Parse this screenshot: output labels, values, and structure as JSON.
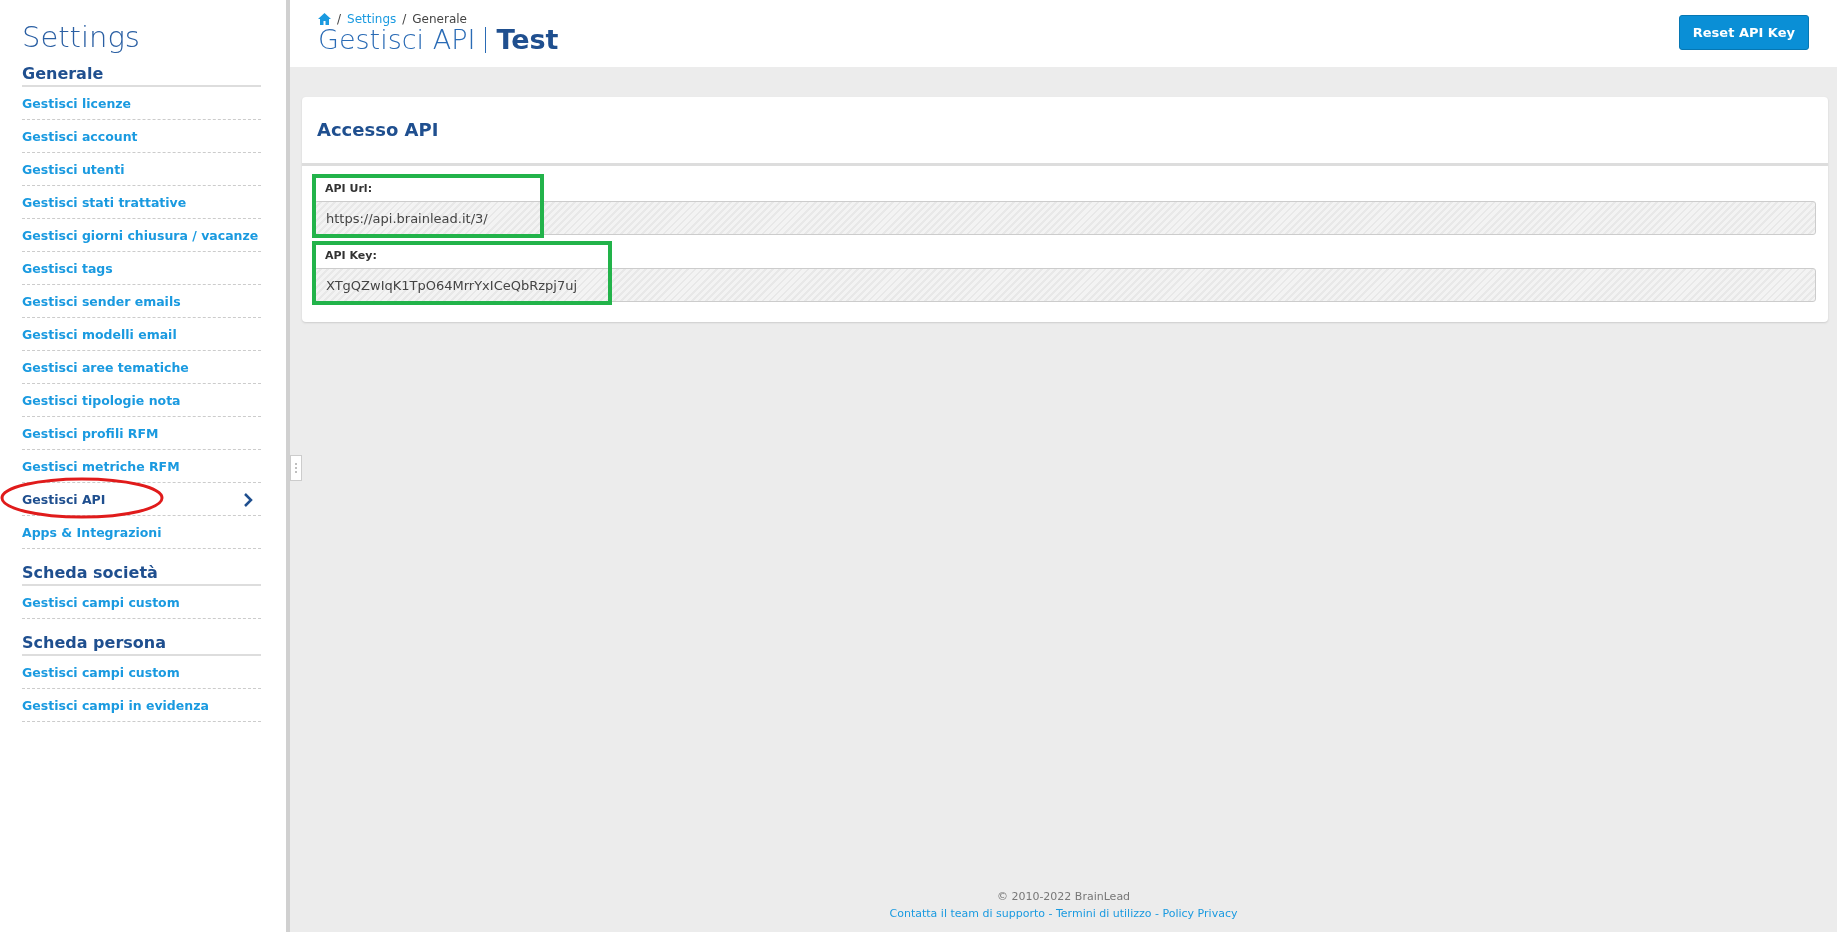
{
  "sidebar": {
    "title": "Settings",
    "sections": [
      {
        "heading": "Generale",
        "items": [
          {
            "label": "Gestisci licenze",
            "selected": false,
            "circled": false
          },
          {
            "label": "Gestisci account",
            "selected": false,
            "circled": false
          },
          {
            "label": "Gestisci utenti",
            "selected": false,
            "circled": false
          },
          {
            "label": "Gestisci stati trattative",
            "selected": false,
            "circled": false
          },
          {
            "label": "Gestisci giorni chiusura / vacanze",
            "selected": false,
            "circled": false
          },
          {
            "label": "Gestisci tags",
            "selected": false,
            "circled": false
          },
          {
            "label": "Gestisci sender emails",
            "selected": false,
            "circled": false
          },
          {
            "label": "Gestisci modelli email",
            "selected": false,
            "circled": false
          },
          {
            "label": "Gestisci aree tematiche",
            "selected": false,
            "circled": false
          },
          {
            "label": "Gestisci tipologie nota",
            "selected": false,
            "circled": false
          },
          {
            "label": "Gestisci profili RFM",
            "selected": false,
            "circled": false
          },
          {
            "label": "Gestisci metriche RFM",
            "selected": false,
            "circled": false
          },
          {
            "label": "Gestisci API",
            "selected": true,
            "circled": true
          },
          {
            "label": "Apps & Integrazioni",
            "selected": false,
            "circled": false
          }
        ]
      },
      {
        "heading": "Scheda società",
        "items": [
          {
            "label": "Gestisci campi custom",
            "selected": false,
            "circled": false
          }
        ]
      },
      {
        "heading": "Scheda persona",
        "items": [
          {
            "label": "Gestisci campi custom",
            "selected": false,
            "circled": false
          },
          {
            "label": "Gestisci campi in evidenza",
            "selected": false,
            "circled": false
          }
        ]
      }
    ]
  },
  "header": {
    "breadcrumb_separator": "/",
    "breadcrumb": [
      {
        "label": "Settings",
        "link": true
      },
      {
        "label": "Generale",
        "link": false
      }
    ],
    "title": "Gestisci API",
    "subtitle": "Test",
    "button": "Reset API Key"
  },
  "card": {
    "title": "Accesso API",
    "fields": [
      {
        "label": "API Url:",
        "value": "https://api.brainlead.it/3/",
        "highlighted": true
      },
      {
        "label": "API Key:",
        "value": "XTgQZwIqK1TpO64MrrYxICeQbRzpj7uj",
        "highlighted": true
      }
    ]
  },
  "footer": {
    "copyright": "© 2010-2022 BrainLead",
    "links": [
      "Contatta il team di supporto",
      "Termini di utilizzo",
      "Policy Privacy"
    ],
    "separator": "-"
  }
}
